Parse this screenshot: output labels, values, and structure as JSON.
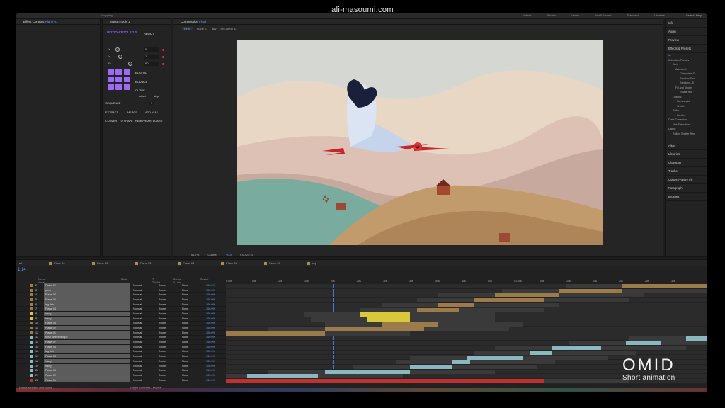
{
  "caption": "ali-masoumi.com",
  "menubar": {
    "items": [
      "Snapping"
    ],
    "workspaces": [
      "Default",
      "Review",
      "Learn",
      "Small Screen",
      "Standard",
      "Libraries"
    ],
    "search": "Search Help"
  },
  "effects_panel": {
    "title": "Effect Controls",
    "layer": "Plane 01",
    "tab_label": "Plane 01"
  },
  "motion_tools": {
    "title": "Motion Tools 2",
    "logo": "MOTION TOOLS 2.0",
    "about": "ABOUT",
    "sliders": [
      {
        "label": "X",
        "value": "0"
      },
      {
        "label": "Y",
        "value": "1"
      },
      {
        "label": "Fr",
        "value": "60"
      }
    ],
    "easing": [
      "ELASTIC",
      "BOUNCE",
      "CLONE"
    ],
    "offset_label": "offset",
    "step_label": "step",
    "sequence": "SEQUENCE",
    "sequence_value": "1",
    "buttons": [
      "EXTRACT",
      "MERGE",
      "ADD NULL",
      "CONVERT TO SHAPE",
      "REMOVE ARTBOARD"
    ]
  },
  "composition": {
    "title": "Composition",
    "name": "Final",
    "breadcrumbs": [
      "Final",
      "Plane 01",
      "sky",
      "Pre-comp 33"
    ],
    "zoom": "66.7%",
    "quality": "Quarter",
    "exposure": "+0.0",
    "timecode": "0:00:21:16"
  },
  "right_panels": [
    "Info",
    "Audio",
    "Preview",
    "Effects & Presets"
  ],
  "effects_presets": {
    "search_value": "fw",
    "tree": [
      "Animation Presets",
      "Text",
      "Animate In",
      "Characters S",
      "Random Sho",
      "Random – S",
      "Fill and Stroke",
      "Rotate Hue",
      "Organic",
      "Hummingbir",
      "Shuffle",
      "Paths",
      "Hurdles",
      "Color Correction",
      "Hue/Saturation",
      "Distort",
      "Rolling Shutter Rep"
    ]
  },
  "right_panels_lower": [
    "Align",
    "Libraries",
    "Character",
    "Tracker",
    "Content-Aware Fill",
    "Paragraph",
    "Brushes"
  ],
  "timeline": {
    "tabs": [
      "all",
      "Plane 01",
      "Plane 02",
      "Plane 03",
      "Plane 04",
      "Plane 06",
      "Plane 07",
      "sky"
    ],
    "timecode": "1;14",
    "columns": [
      "Source Name",
      "Mode",
      "T TrkMat",
      "Parent & Link",
      "Stretch"
    ],
    "ruler": [
      "0:00s",
      "05s",
      "10s",
      "15s",
      "20s",
      "25s",
      "30s",
      "35s",
      "40s",
      "45s",
      "50s",
      "01:00s",
      "05s",
      "10s",
      "15s",
      "20s",
      "25s",
      "30s"
    ],
    "layers": [
      {
        "n": "2",
        "name": "Plane 02",
        "color": "#9b7b4a"
      },
      {
        "n": "3",
        "name": "jump",
        "color": "#9b7b4a"
      },
      {
        "n": "4",
        "name": "Plane 07",
        "color": "#9b7b4a"
      },
      {
        "n": "5",
        "name": "Plane 06",
        "color": "#9b7b4a"
      },
      {
        "n": "6",
        "name": "leg fish",
        "color": "#9b7b4a"
      },
      {
        "n": "7",
        "name": "Plane 04",
        "color": "#9b7b4a"
      },
      {
        "n": "8",
        "name": "hang",
        "color": "#d8c83a"
      },
      {
        "n": "9",
        "name": "hang",
        "color": "#d8c83a"
      },
      {
        "n": "10",
        "name": "Plane 03",
        "color": "#9b7b4a"
      },
      {
        "n": "11",
        "name": "Plane 02",
        "color": "#9b7b4a"
      },
      {
        "n": "12",
        "name": "Plane 01",
        "color": "#9b7b4a"
      },
      {
        "n": "13",
        "name": "flush selected.mp4",
        "color": "#8ab8c0"
      },
      {
        "n": "14",
        "name": "Plane 07",
        "color": "#8ab8c0"
      },
      {
        "n": "15",
        "name": "Plane 06",
        "color": "#8ab8c0"
      },
      {
        "n": "16",
        "name": "leg fish",
        "color": "#8ab8c0"
      },
      {
        "n": "17",
        "name": "Plane 04",
        "color": "#8ab8c0"
      },
      {
        "n": "18",
        "name": "hang",
        "color": "#8ab8c0"
      },
      {
        "n": "19",
        "name": "hang",
        "color": "#8ab8c0"
      },
      {
        "n": "20",
        "name": "Plane 03",
        "color": "#8ab8c0"
      },
      {
        "n": "21",
        "name": "Plane 02",
        "color": "#8ab8c0"
      },
      {
        "n": "22",
        "name": "Plane 01",
        "color": "#c03030"
      }
    ],
    "mode": "Normal",
    "trkmat": "None",
    "parent": "None",
    "stretch": "100.0%",
    "footer_left": "Frame Render Time 34ms",
    "footer_mid": "Toggle Switches / Modes"
  },
  "brand": {
    "title": "OMID",
    "subtitle": "Short animation"
  }
}
